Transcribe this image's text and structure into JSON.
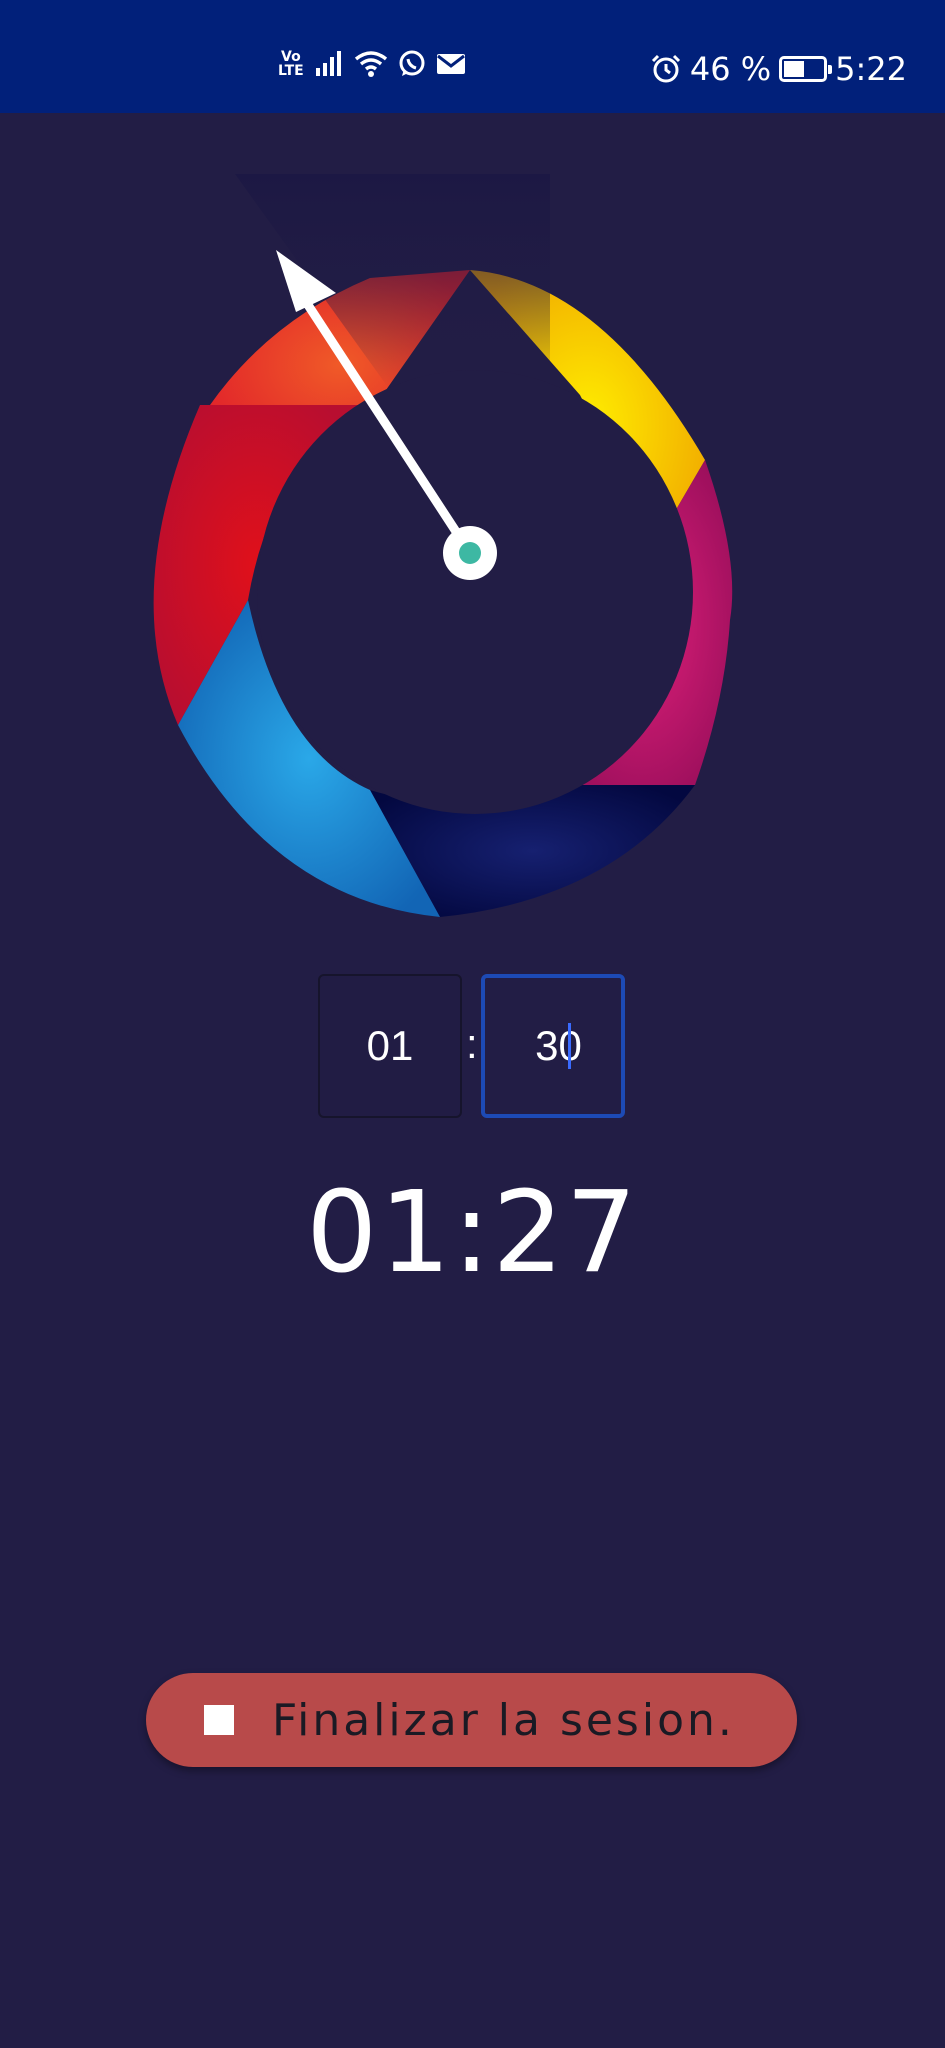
{
  "status_bar": {
    "network_label_top": "Vo",
    "network_label_bottom": "LTE",
    "battery_percent": "46 %",
    "time": "5:22",
    "icons": [
      "volte-icon",
      "signal-icon",
      "wifi-icon",
      "whatsapp-icon",
      "mail-icon",
      "alarm-icon",
      "battery-charging-icon"
    ]
  },
  "wheel": {
    "segments": [
      "orange",
      "yellow",
      "magenta",
      "navy",
      "blue",
      "red"
    ],
    "center_dot_color": "#3db8a3"
  },
  "timer_input": {
    "minutes": "01",
    "separator": ":",
    "seconds": "30"
  },
  "countdown": "01:27",
  "end_button": {
    "label": "Finalizar la sesion."
  },
  "colors": {
    "background": "#221d45",
    "status_bar": "#01207a",
    "button": "#b84a4a",
    "focus_border": "#1d4ab5"
  }
}
